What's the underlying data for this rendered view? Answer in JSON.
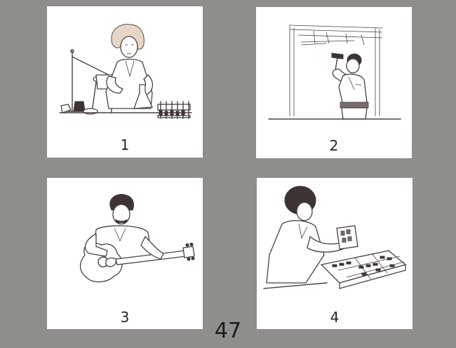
{
  "cards": [
    {
      "label": "1",
      "icon": "scientist-lab-illustration"
    },
    {
      "label": "2",
      "icon": "carpenter-hammer-illustration"
    },
    {
      "label": "3",
      "icon": "guitar-player-illustration"
    },
    {
      "label": "4",
      "icon": "electronics-worker-illustration"
    }
  ],
  "page_number": "47"
}
